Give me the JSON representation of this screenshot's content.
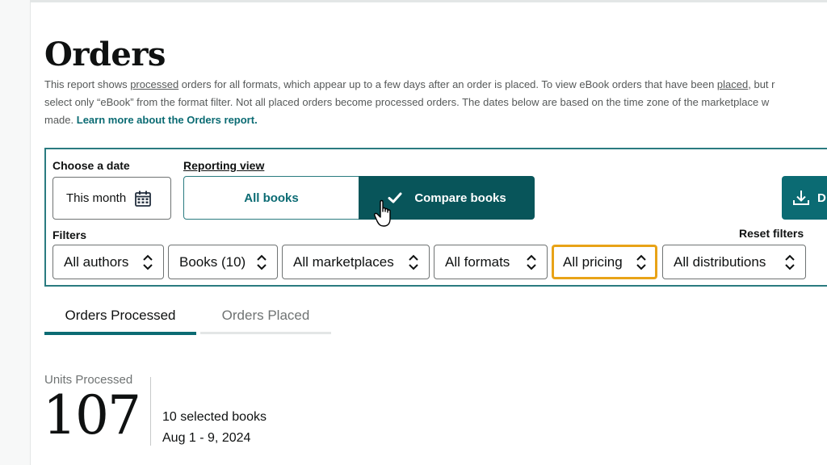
{
  "page": {
    "title": "Orders",
    "description": {
      "part1": "This report shows ",
      "processed_word": "processed",
      "part2": " orders for all formats, which appear up to a few days after an order is placed. To view eBook orders that have been ",
      "placed_word": "placed",
      "part3": ", but r",
      "line2": "select only “eBook” from the format filter. Not all placed orders become processed orders. The dates below are based on the time zone of the marketplace w",
      "line3_prefix": "made.  ",
      "learn_more": "Learn more about the Orders report."
    }
  },
  "date": {
    "label": "Choose a date",
    "value": "This month",
    "icon": "calendar-icon"
  },
  "reporting_view": {
    "label": "Reporting view",
    "options": [
      {
        "label": "All books",
        "selected": false
      },
      {
        "label": "Compare books",
        "selected": true,
        "icon": "check-icon"
      }
    ]
  },
  "download": {
    "label": "D",
    "icon": "download-icon"
  },
  "filters": {
    "label": "Filters",
    "reset_label": "Reset filters",
    "items": [
      {
        "label": "All authors"
      },
      {
        "label": "Books (10)"
      },
      {
        "label": "All marketplaces"
      },
      {
        "label": "All formats"
      },
      {
        "label": "All pricing",
        "focused": true
      },
      {
        "label": "All distributions"
      }
    ]
  },
  "tabs": [
    {
      "label": "Orders Processed",
      "active": true
    },
    {
      "label": "Orders Placed",
      "active": false
    }
  ],
  "summary": {
    "units_label": "Units Processed",
    "units_value": "107",
    "books_selected": "10 selected books",
    "date_range": "Aug 1 - 9, 2024"
  },
  "colors": {
    "teal_primary": "#0b6b73",
    "teal_dark": "#08555a",
    "focus_orange": "#e8a317"
  }
}
